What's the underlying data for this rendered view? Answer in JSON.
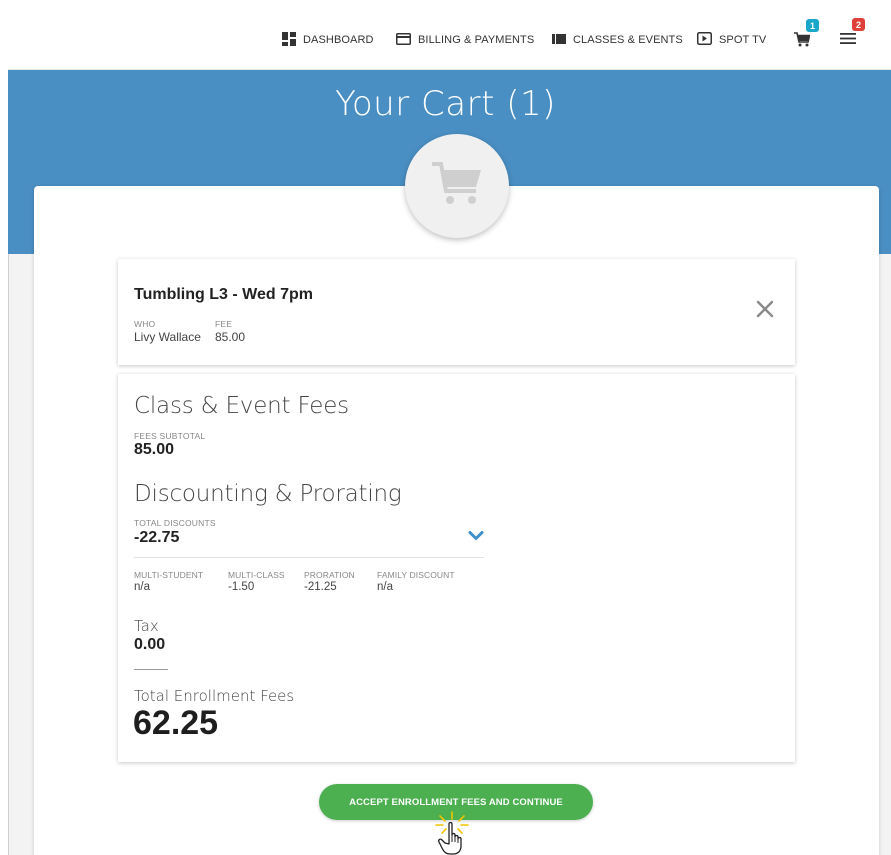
{
  "nav": {
    "items": [
      {
        "label": "DASHBOARD",
        "icon": "dashboard-icon"
      },
      {
        "label": "BILLING & PAYMENTS",
        "icon": "credit-card-icon"
      },
      {
        "label": "CLASSES & EVENTS",
        "icon": "classes-icon"
      },
      {
        "label": "SPOT TV",
        "icon": "play-icon"
      }
    ],
    "cart_badge": "1",
    "menu_badge": "2",
    "cart_badge_color": "#1aa7c9",
    "menu_badge_color": "#e0403a"
  },
  "banner": {
    "title": "Your Cart (1)",
    "color": "#4a8fc3"
  },
  "item": {
    "title": "Tumbling L3 - Wed 7pm",
    "who_label": "WHO",
    "who_value": "Livy Wallace",
    "fee_label": "FEE",
    "fee_value": "85.00"
  },
  "fees": {
    "class_heading": "Class & Event Fees",
    "subtotal_label": "FEES SUBTOTAL",
    "subtotal_value": "85.00",
    "discount_heading": "Discounting & Prorating",
    "discounts_label": "TOTAL DISCOUNTS",
    "discounts_value": "-22.75",
    "breakdown": [
      {
        "label": "MULTI-STUDENT",
        "value": "n/a"
      },
      {
        "label": "MULTI-CLASS",
        "value": "-1.50"
      },
      {
        "label": "PRORATION",
        "value": "-21.25"
      },
      {
        "label": "FAMILY DISCOUNT",
        "value": "n/a"
      }
    ],
    "tax_label": "Tax",
    "tax_value": "0.00",
    "total_label": "Total Enrollment Fees",
    "total_value": "62.25"
  },
  "accept_button": {
    "label": "ACCEPT ENROLLMENT FEES AND CONTINUE",
    "color": "#4caf50"
  },
  "accent_color": "#4a8fc3"
}
